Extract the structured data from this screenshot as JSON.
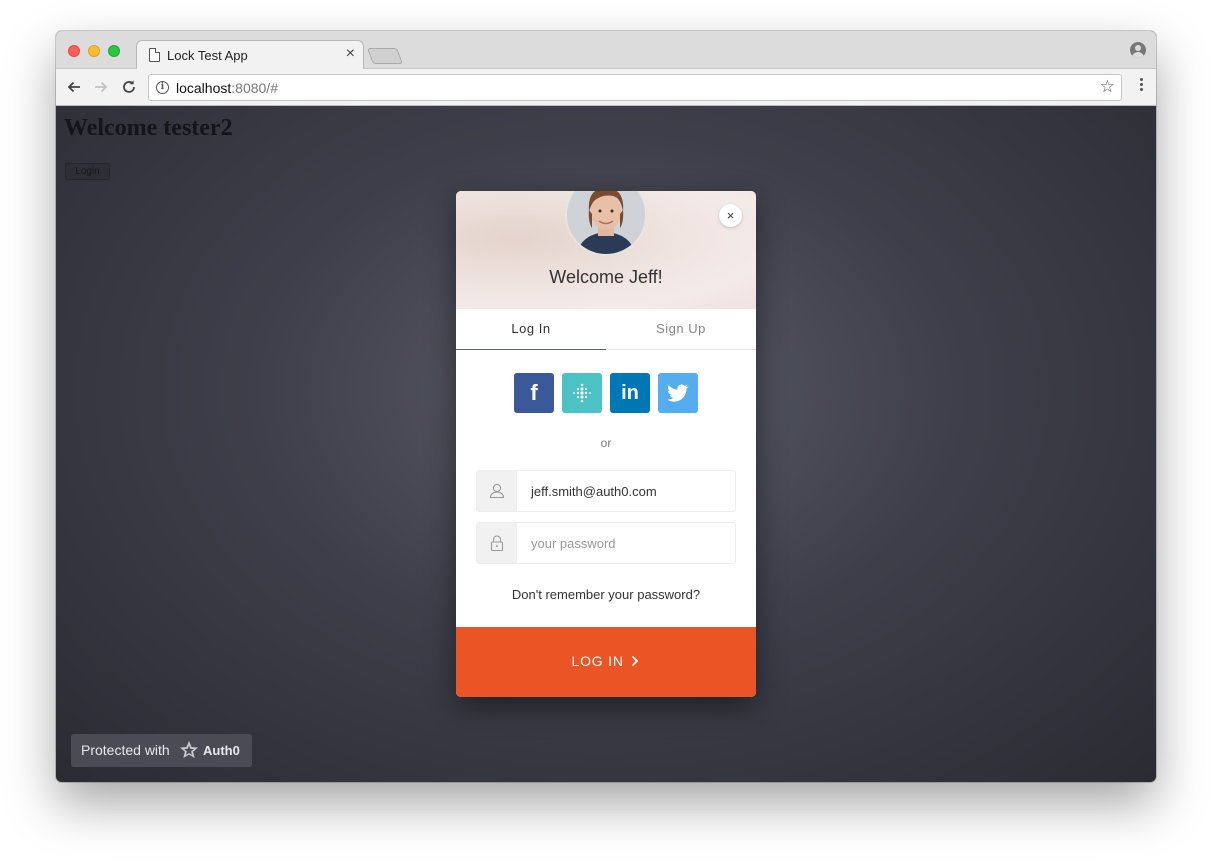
{
  "browser": {
    "tab_title": "Lock Test App",
    "tab_close": "×",
    "url_host": "localhost",
    "url_rest": ":8080/#"
  },
  "page": {
    "heading": "Welcome tester2",
    "login_button": "Login",
    "badge": {
      "text": "Protected with",
      "brand": "Auth0"
    }
  },
  "lock": {
    "welcome": "Welcome Jeff!",
    "close": "×",
    "tabs": [
      {
        "label": "Log In",
        "active": true
      },
      {
        "label": "Sign Up",
        "active": false
      }
    ],
    "social": [
      {
        "name": "facebook",
        "color": "#3b5998"
      },
      {
        "name": "fitbit",
        "color": "#4cc2c4"
      },
      {
        "name": "linkedin",
        "color": "#0077b5"
      },
      {
        "name": "twitter",
        "color": "#55acee"
      }
    ],
    "or_label": "or",
    "email_value": "jeff.smith@auth0.com",
    "password_placeholder": "your password",
    "forgot_link": "Don't remember your password?",
    "submit_label": "LOG IN",
    "submit_color": "#eb5424"
  }
}
